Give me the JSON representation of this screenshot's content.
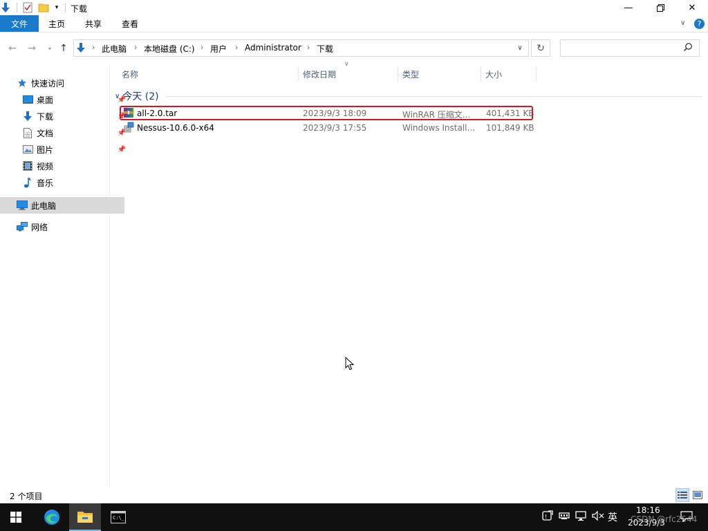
{
  "window": {
    "title": "下载"
  },
  "ribbon": {
    "tabs": [
      "文件",
      "主页",
      "共享",
      "查看"
    ]
  },
  "address": {
    "crumbs": [
      "此电脑",
      "本地磁盘 (C:)",
      "用户",
      "Administrator",
      "下载"
    ],
    "search_placeholder": ""
  },
  "nav": {
    "quick_access": "快速访问",
    "quick_items": [
      {
        "label": "桌面",
        "pinned": true
      },
      {
        "label": "下载",
        "pinned": true
      },
      {
        "label": "文档",
        "pinned": true
      },
      {
        "label": "图片",
        "pinned": true
      },
      {
        "label": "视频",
        "pinned": false
      },
      {
        "label": "音乐",
        "pinned": false
      }
    ],
    "this_pc": "此电脑",
    "network": "网络"
  },
  "columns": [
    "名称",
    "修改日期",
    "类型",
    "大小"
  ],
  "group": {
    "label": "今天 (2)"
  },
  "files": [
    {
      "name": "all-2.0.tar",
      "date": "2023/9/3 18:09",
      "type": "WinRAR 压缩文...",
      "size": "401,431 KB",
      "icon": "winrar-archive-icon"
    },
    {
      "name": "Nessus-10.6.0-x64",
      "date": "2023/9/3 17:55",
      "type": "Windows Install...",
      "size": "101,849 KB",
      "icon": "msi-installer-icon"
    }
  ],
  "status": {
    "count": "2 个项目"
  },
  "taskbar": {
    "ime": "英",
    "time": "18:16",
    "date": "2023/9/3",
    "watermark": "CSDN @rfc2544"
  },
  "colors": {
    "accent": "#1979ca",
    "highlight_border": "#e0141e",
    "taskbar": "#101010"
  }
}
